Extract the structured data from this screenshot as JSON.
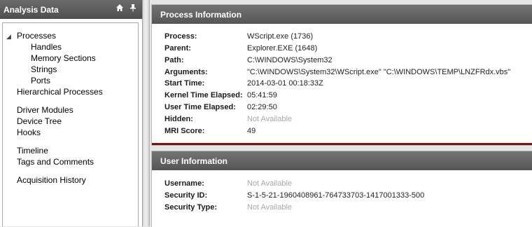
{
  "sidebar": {
    "title": "Analysis Data",
    "expander_symbol": "◢",
    "items": [
      {
        "label": "Processes"
      },
      {
        "label": "Handles"
      },
      {
        "label": "Memory Sections"
      },
      {
        "label": "Strings"
      },
      {
        "label": "Ports"
      },
      {
        "label": "Hierarchical Processes"
      },
      {
        "label": "Driver Modules"
      },
      {
        "label": "Device Tree"
      },
      {
        "label": "Hooks"
      },
      {
        "label": "Timeline"
      },
      {
        "label": "Tags and Comments"
      },
      {
        "label": "Acquisition History"
      }
    ]
  },
  "process_info": {
    "title": "Process Information",
    "fields": [
      {
        "label": "Process:",
        "value": "WScript.exe (1736)"
      },
      {
        "label": "Parent:",
        "value": "Explorer.EXE (1648)"
      },
      {
        "label": "Path:",
        "value": "C:\\WINDOWS\\System32"
      },
      {
        "label": "Arguments:",
        "value": "\"C:\\WINDOWS\\System32\\WScript.exe\" \"C:\\WINDOWS\\TEMP\\LNZFRdx.vbs\""
      },
      {
        "label": "Start Time:",
        "value": "2014-03-01 00:18:33Z"
      },
      {
        "label": "Kernel Time Elapsed:",
        "value": "05:41:59"
      },
      {
        "label": "User Time Elapsed:",
        "value": "02:29:50"
      },
      {
        "label": "Hidden:",
        "value": "Not Available"
      },
      {
        "label": "MRI Score:",
        "value": "49"
      }
    ]
  },
  "user_info": {
    "title": "User Information",
    "fields": [
      {
        "label": "Username:",
        "value": "Not Available"
      },
      {
        "label": "Security ID:",
        "value": "S-1-5-21-1960408961-764733703-1417001333-500"
      },
      {
        "label": "Security Type:",
        "value": "Not Available"
      }
    ]
  },
  "colors": {
    "not_available": "#a8a8a8",
    "accent_line": "#8b1a1a"
  },
  "icons": [
    "home-icon",
    "pin-icon",
    "expand-triangle-icon"
  ]
}
